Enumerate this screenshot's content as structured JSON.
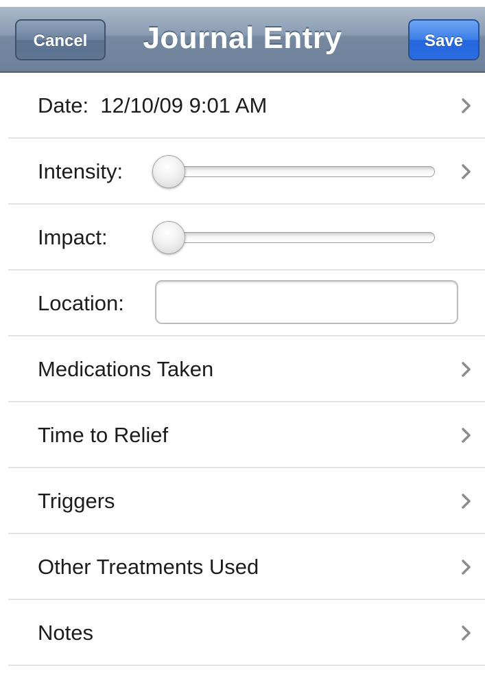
{
  "navbar": {
    "title": "Journal Entry",
    "cancel_label": "Cancel",
    "save_label": "Save"
  },
  "form": {
    "date": {
      "label": "Date:",
      "value": "12/10/09 9:01 AM"
    },
    "intensity": {
      "label": "Intensity:",
      "level": 0
    },
    "impact": {
      "label": "Impact:",
      "level": 0
    },
    "location": {
      "label": "Location:",
      "value": "",
      "placeholder": ""
    },
    "medications": {
      "label": "Medications Taken"
    },
    "time_to_relief": {
      "label": "Time to Relief"
    },
    "triggers": {
      "label": "Triggers"
    },
    "other_treatments": {
      "label": "Other Treatments Used"
    },
    "notes": {
      "label": "Notes"
    }
  },
  "colors": {
    "navbar": "#8a9db3",
    "save_button": "#3b7ee8",
    "cancel_button": "#6b829f",
    "separator": "#e3e3e3"
  },
  "icons": {
    "disclosure": "chevron-right-icon"
  }
}
